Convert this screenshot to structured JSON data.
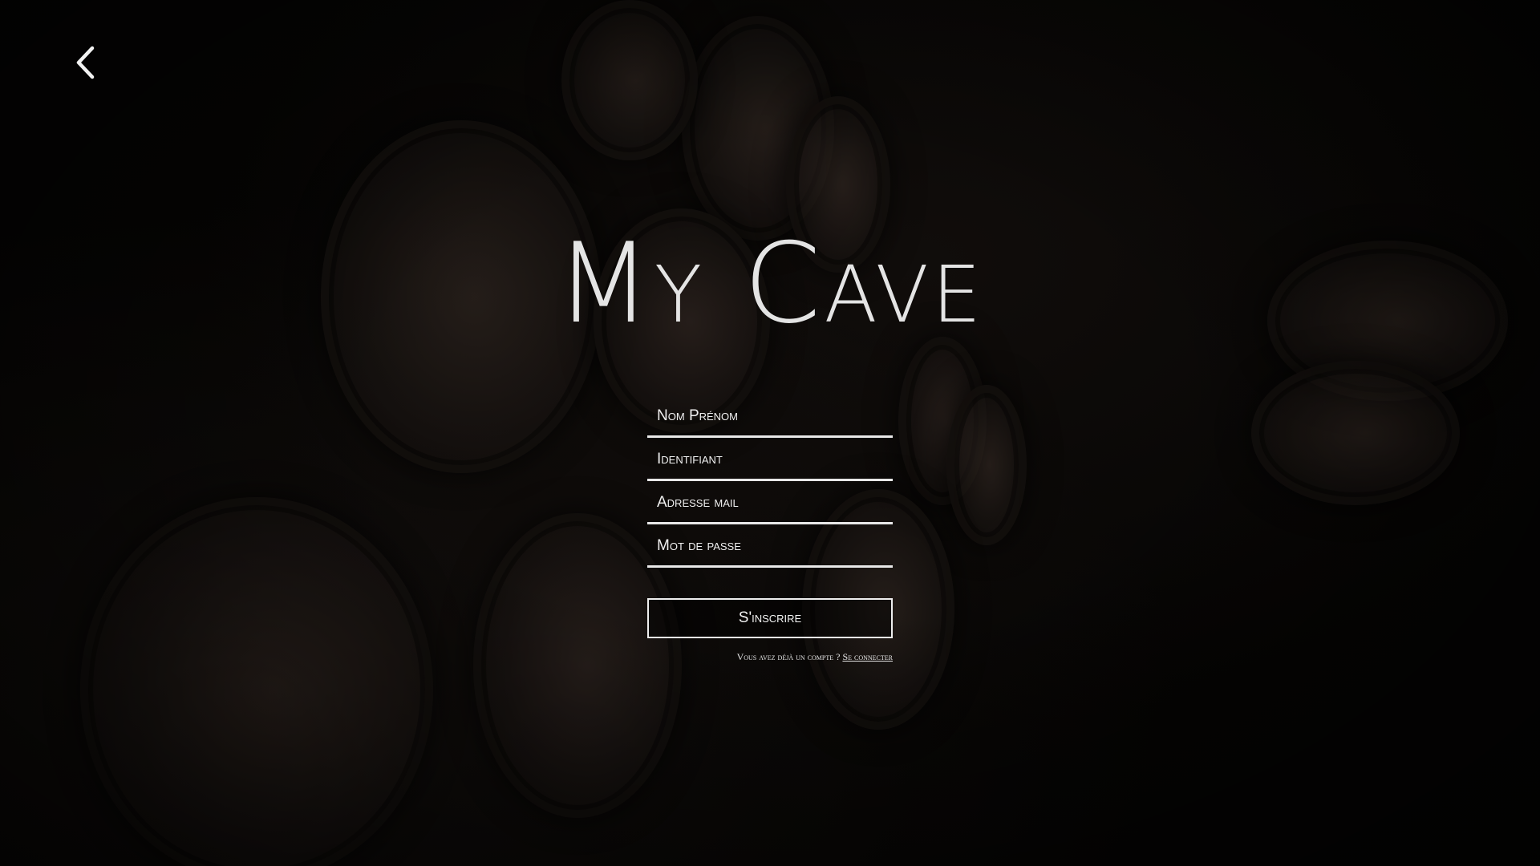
{
  "app": {
    "title": "My Cave"
  },
  "nav": {
    "back_icon": "chevron-left-icon"
  },
  "form": {
    "fields": [
      {
        "name": "full-name",
        "placeholder": "Nom Prénom",
        "value": ""
      },
      {
        "name": "username",
        "placeholder": "Identifiant",
        "value": ""
      },
      {
        "name": "email",
        "placeholder": "Adresse mail",
        "value": ""
      },
      {
        "name": "password",
        "placeholder": "Mot de passe",
        "value": ""
      }
    ],
    "submit_label": "S'inscrire",
    "login_prompt": "Vous avez déjà un compte ?",
    "login_link": "Se connecter"
  },
  "colors": {
    "background": "#050403",
    "text": "#f2f2f2",
    "title": "#e4e4e4"
  }
}
